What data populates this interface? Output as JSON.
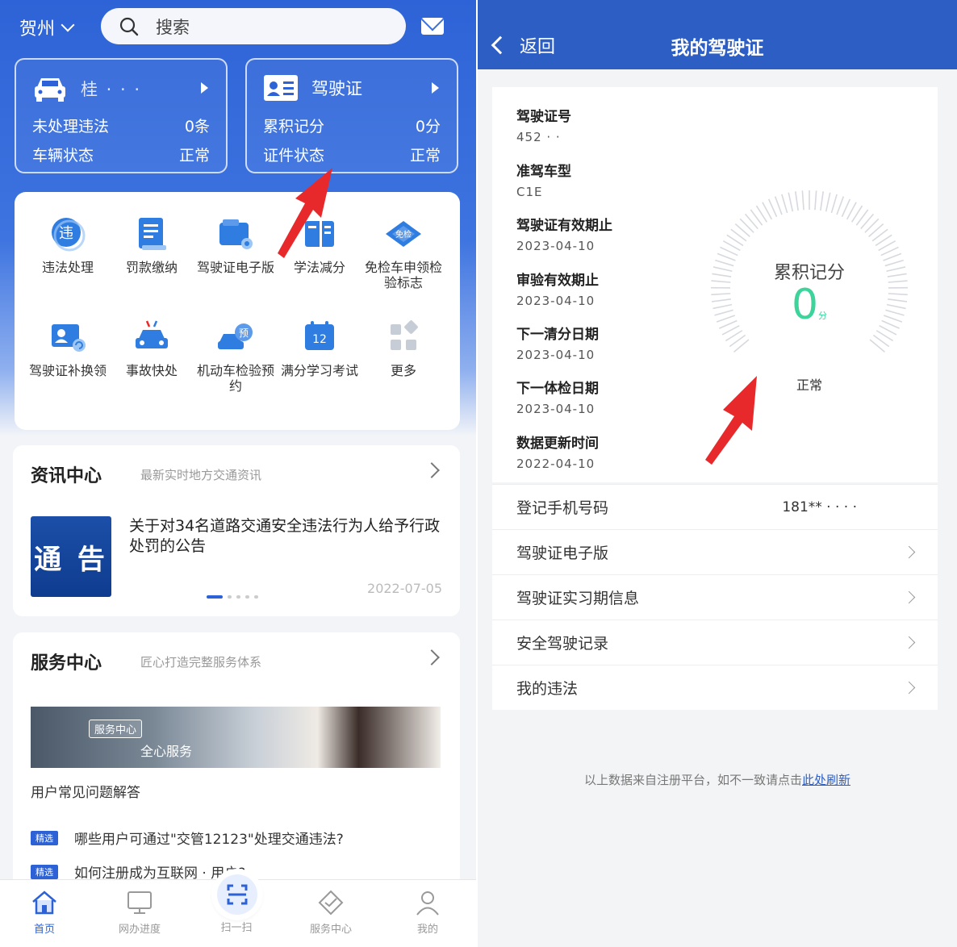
{
  "left": {
    "city": "贺州",
    "search_placeholder": "搜索",
    "vehicle_card": {
      "plate": "桂 · · ·",
      "rows": [
        {
          "label": "未处理违法",
          "value": "0条"
        },
        {
          "label": "车辆状态",
          "value": "正常"
        }
      ]
    },
    "license_card": {
      "title": "驾驶证",
      "rows": [
        {
          "label": "累积记分",
          "value": "0分"
        },
        {
          "label": "证件状态",
          "value": "正常"
        }
      ]
    },
    "services": [
      {
        "label": "违法处理",
        "icon": "violation-icon"
      },
      {
        "label": "罚款缴纳",
        "icon": "fine-payment-icon"
      },
      {
        "label": "驾驶证电子版",
        "icon": "e-license-icon"
      },
      {
        "label": "学法减分",
        "icon": "study-book-icon"
      },
      {
        "label": "免检车申领检验标志",
        "icon": "exempt-inspection-icon"
      },
      {
        "label": "驾驶证补换领",
        "icon": "license-replace-icon"
      },
      {
        "label": "事故快处",
        "icon": "accident-car-icon"
      },
      {
        "label": "机动车检验预约",
        "icon": "inspection-booking-icon"
      },
      {
        "label": "满分学习考试",
        "icon": "calendar-12-icon"
      },
      {
        "label": "更多",
        "icon": "more-grid-icon"
      }
    ],
    "news": {
      "title": "资讯中心",
      "subtitle": "最新实时地方交通资讯",
      "thumb_text": "通 告",
      "headline": "关于对34名道路交通安全违法行为人给予行政处罚的公告",
      "date": "2022-07-05"
    },
    "service_center": {
      "title": "服务中心",
      "subtitle": "匠心打造完整服务体系",
      "banner_tag": "服务中心",
      "banner_slogan": "全心服务",
      "faq_title": "用户常见问题解答",
      "faq_badge": "精选",
      "faqs": [
        "哪些用户可通过\"交管12123\"处理交通违法?",
        "如何注册成为互联网 · 用户?"
      ]
    },
    "tabs": [
      {
        "label": "首页",
        "icon": "home-icon"
      },
      {
        "label": "网办进度",
        "icon": "monitor-icon"
      },
      {
        "label": "扫一扫",
        "icon": "scan-icon"
      },
      {
        "label": "服务中心",
        "icon": "handshake-icon"
      },
      {
        "label": "我的",
        "icon": "user-icon"
      }
    ],
    "colors": {
      "primary": "#2d63d6",
      "active_tab": "#2c62d6",
      "alert": "#e8292c"
    }
  },
  "right": {
    "back_label": "返回",
    "title": "我的驾驶证",
    "fields": [
      {
        "key": "驾驶证号",
        "value": "452 · ·"
      },
      {
        "key": "准驾车型",
        "value": "C1E"
      },
      {
        "key": "驾驶证有效期止",
        "value": "2023-04-10"
      },
      {
        "key": "审验有效期止",
        "value": "2023-04-10"
      },
      {
        "key": "下一清分日期",
        "value": "2023-04-10"
      },
      {
        "key": "下一体检日期",
        "value": "2023-04-10"
      },
      {
        "key": "数据更新时间",
        "value": "2022-04-10"
      }
    ],
    "gauge": {
      "label": "累积记分",
      "value": "0",
      "unit": "分",
      "status": "正常",
      "color": "#3cd49b"
    },
    "list": [
      {
        "label": "登记手机号码",
        "value": "181** · · · ·"
      },
      {
        "label": "驾驶证电子版"
      },
      {
        "label": "驾驶证实习期信息"
      },
      {
        "label": "安全驾驶记录"
      },
      {
        "label": "我的违法"
      }
    ],
    "footnote_text": "以上数据来自注册平台，如不一致请点击",
    "footnote_link": "此处刷新"
  }
}
